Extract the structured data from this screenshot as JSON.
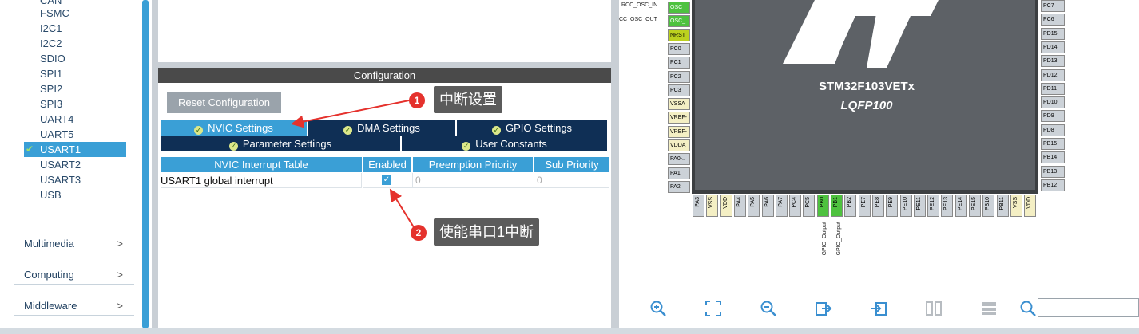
{
  "sidebar": {
    "peripherals": [
      "CAN",
      "FSMC",
      "I2C1",
      "I2C2",
      "SDIO",
      "SPI1",
      "SPI2",
      "SPI3",
      "UART4",
      "UART5",
      "USART1",
      "USART2",
      "USART3",
      "USB"
    ],
    "selected": "USART1",
    "categories": [
      "Multimedia",
      "Computing",
      "Middleware"
    ]
  },
  "config": {
    "header": "Configuration",
    "reset_label": "Reset Configuration",
    "tabs_row1": [
      "NVIC Settings",
      "DMA Settings",
      "GPIO Settings"
    ],
    "tabs_row2": [
      "Parameter Settings",
      "User Constants"
    ],
    "active_tab": "NVIC Settings",
    "table_headers": [
      "NVIC Interrupt Table",
      "Enabled",
      "Preemption Priority",
      "Sub Priority"
    ],
    "row": {
      "name": "USART1 global interrupt",
      "enabled": true,
      "preemption": "0",
      "sub": "0"
    }
  },
  "annotations": [
    {
      "num": "1",
      "text": "中断设置"
    },
    {
      "num": "2",
      "text": "使能串口1中断"
    }
  ],
  "chip": {
    "name": "STM32F103VETx",
    "package": "LQFP100",
    "signals_left": [
      "RCC_OSC_IN",
      "CC_OSC_OUT"
    ],
    "left_pins": [
      "OSC_",
      "OSC_",
      "NRST",
      "PC0",
      "PC1",
      "PC2",
      "PC3",
      "VSSA",
      "VREF-",
      "VREF-",
      "VDDA",
      "PA0-..",
      "PA1",
      "PA2"
    ],
    "right_pins": [
      "PC7",
      "PC6",
      "PD15",
      "PD14",
      "PD13",
      "PD12",
      "PD11",
      "PD10",
      "PD9",
      "PD8",
      "PB15",
      "PB14",
      "PB13",
      "PB12"
    ],
    "bottom_pins": [
      "PA3",
      "VSS",
      "VDD",
      "PA4",
      "PA5",
      "PA6",
      "PA7",
      "PC4",
      "PC5",
      "PB0",
      "PB1",
      "PB2",
      "PE7",
      "PE8",
      "PE9",
      "PE10",
      "PE11",
      "PE12",
      "PE13",
      "PE14",
      "PE15",
      "PB10",
      "PB11",
      "VSS",
      "VDD"
    ],
    "gpio_labels": [
      "GPIO_Output",
      "GPIO_Output"
    ]
  },
  "toolbar": {
    "icons": [
      "zoom-in-icon",
      "fit-icon",
      "zoom-out-icon",
      "export-icon",
      "import-icon",
      "split-icon",
      "layout-icon",
      "search-icon"
    ]
  },
  "colors": {
    "accent": "#3a9fd6",
    "tab_dark": "#0f2f55",
    "badge": "#e5322d",
    "pin_green": "#4ec23f"
  }
}
